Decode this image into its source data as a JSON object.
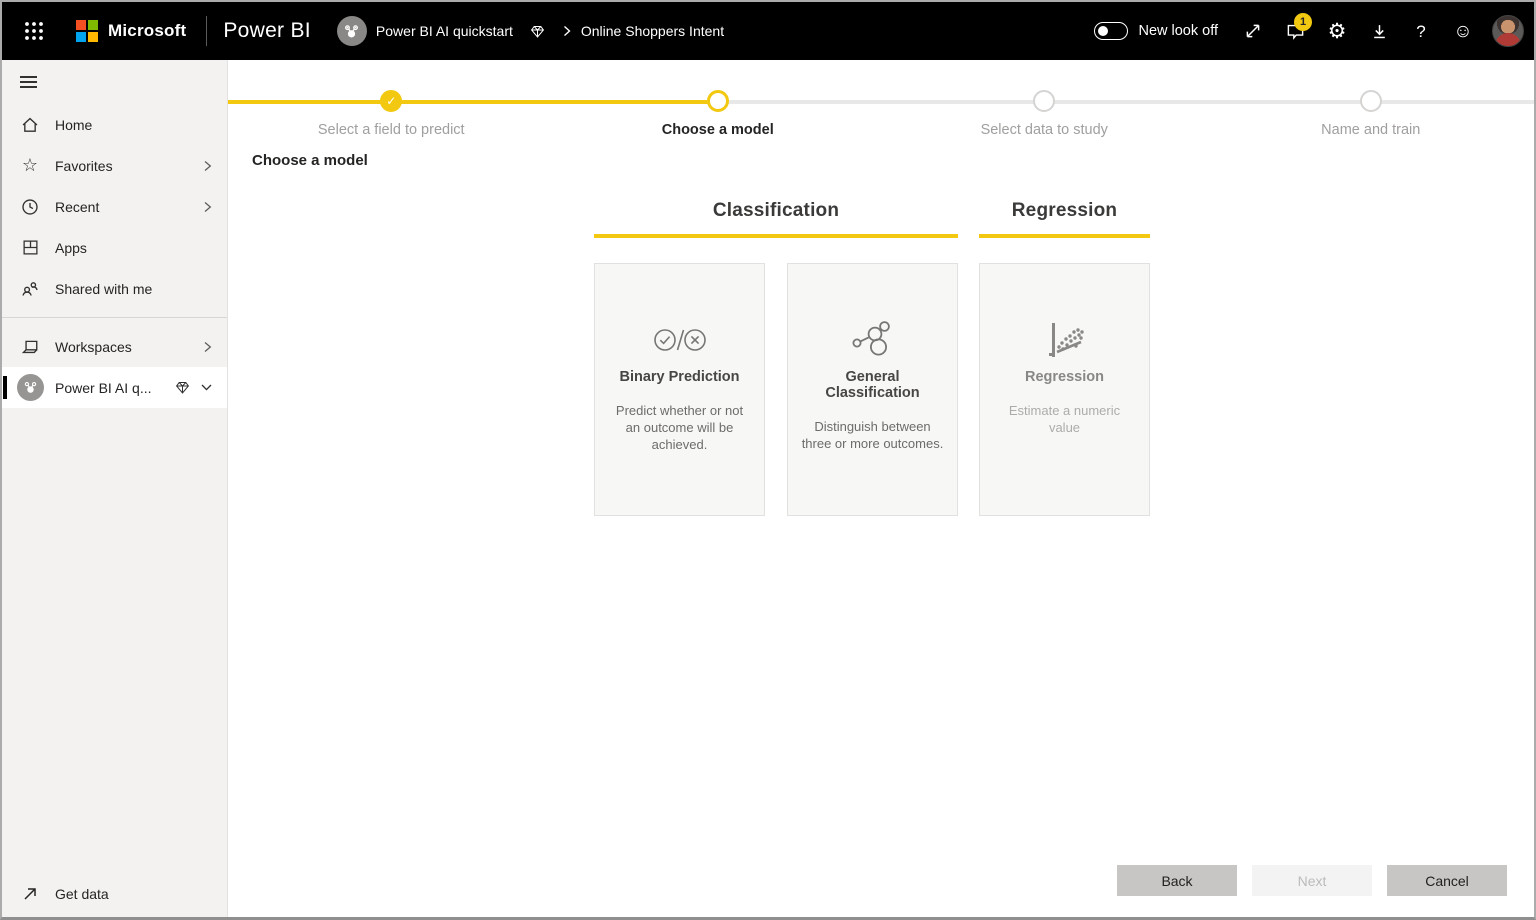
{
  "header": {
    "microsoft_label": "Microsoft",
    "app_name": "Power BI",
    "breadcrumb": {
      "workspace": "Power BI AI quickstart",
      "page": "Online Shoppers Intent"
    },
    "new_look": {
      "label": "New look off",
      "state": "off"
    },
    "notification_count": "1",
    "help_glyph": "?"
  },
  "sidebar": {
    "items": [
      {
        "label": "Home"
      },
      {
        "label": "Favorites"
      },
      {
        "label": "Recent"
      },
      {
        "label": "Apps"
      },
      {
        "label": "Shared with me"
      },
      {
        "label": "Workspaces"
      },
      {
        "label": "Power BI AI q..."
      }
    ],
    "get_data_label": "Get data"
  },
  "stepper": {
    "steps": [
      {
        "label": "Select a field to predict",
        "state": "complete"
      },
      {
        "label": "Choose a model",
        "state": "current"
      },
      {
        "label": "Select data to study",
        "state": "upcoming"
      },
      {
        "label": "Name and train",
        "state": "upcoming"
      }
    ],
    "check_glyph": "✓"
  },
  "main": {
    "heading": "Choose a model",
    "groups": [
      {
        "title": "Classification"
      },
      {
        "title": "Regression"
      }
    ],
    "cards": [
      {
        "title": "Binary Prediction",
        "description": "Predict whether or not an outcome will be achieved.",
        "group": "Classification",
        "disabled": false
      },
      {
        "title": "General Classification",
        "description": "Distinguish between three or more outcomes.",
        "group": "Classification",
        "disabled": false
      },
      {
        "title": "Regression",
        "description": "Estimate a numeric value",
        "group": "Regression",
        "disabled": true
      }
    ],
    "buttons": {
      "back": "Back",
      "next": "Next",
      "cancel": "Cancel"
    }
  },
  "colors": {
    "accent_yellow": "#f2c811",
    "header_bg": "#000000",
    "sidebar_bg": "#f3f2f1"
  }
}
